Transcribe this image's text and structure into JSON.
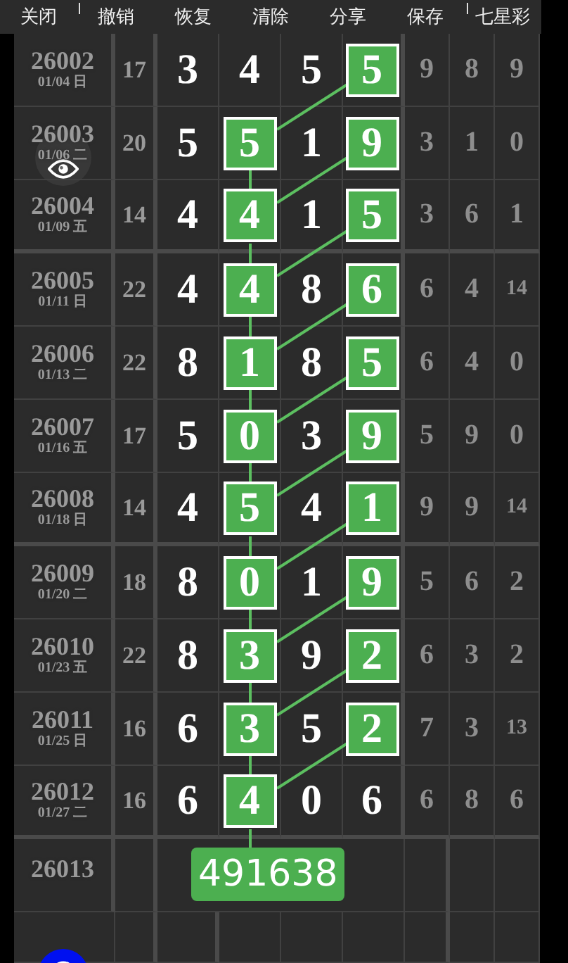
{
  "toolbar": [
    {
      "label": "关闭"
    },
    {
      "label": "撤销"
    },
    {
      "label": "恢复"
    },
    {
      "label": "清除"
    },
    {
      "label": "分享"
    },
    {
      "label": "保存"
    },
    {
      "label": "七星彩"
    }
  ],
  "rows": [
    {
      "issue": "26002",
      "date": "01/04 日",
      "sum": "17",
      "digits": [
        {
          "value": "3",
          "marked": false
        },
        {
          "value": "4",
          "marked": false
        },
        {
          "value": "5",
          "marked": false
        },
        {
          "value": "5",
          "marked": true
        }
      ],
      "extra": [
        "9",
        "8",
        "9"
      ]
    },
    {
      "issue": "26003",
      "date": "01/06 二",
      "sum": "20",
      "digits": [
        {
          "value": "5",
          "marked": false
        },
        {
          "value": "5",
          "marked": true
        },
        {
          "value": "1",
          "marked": false
        },
        {
          "value": "9",
          "marked": true
        }
      ],
      "extra": [
        "3",
        "1",
        "0"
      ]
    },
    {
      "issue": "26004",
      "date": "01/09 五",
      "sum": "14",
      "digits": [
        {
          "value": "4",
          "marked": false
        },
        {
          "value": "4",
          "marked": true
        },
        {
          "value": "1",
          "marked": false
        },
        {
          "value": "5",
          "marked": true
        }
      ],
      "extra": [
        "3",
        "6",
        "1"
      ]
    },
    {
      "issue": "26005",
      "date": "01/11 日",
      "sum": "22",
      "digits": [
        {
          "value": "4",
          "marked": false
        },
        {
          "value": "4",
          "marked": true
        },
        {
          "value": "8",
          "marked": false
        },
        {
          "value": "6",
          "marked": true
        }
      ],
      "extra": [
        "6",
        "4",
        "14"
      ]
    },
    {
      "issue": "26006",
      "date": "01/13 二",
      "sum": "22",
      "digits": [
        {
          "value": "8",
          "marked": false
        },
        {
          "value": "1",
          "marked": true
        },
        {
          "value": "8",
          "marked": false
        },
        {
          "value": "5",
          "marked": true
        }
      ],
      "extra": [
        "6",
        "4",
        "0"
      ]
    },
    {
      "issue": "26007",
      "date": "01/16 五",
      "sum": "17",
      "digits": [
        {
          "value": "5",
          "marked": false
        },
        {
          "value": "0",
          "marked": true
        },
        {
          "value": "3",
          "marked": false
        },
        {
          "value": "9",
          "marked": true
        }
      ],
      "extra": [
        "5",
        "9",
        "0"
      ]
    },
    {
      "issue": "26008",
      "date": "01/18 日",
      "sum": "14",
      "digits": [
        {
          "value": "4",
          "marked": false
        },
        {
          "value": "5",
          "marked": true
        },
        {
          "value": "4",
          "marked": false
        },
        {
          "value": "1",
          "marked": true
        }
      ],
      "extra": [
        "9",
        "9",
        "14"
      ]
    },
    {
      "issue": "26009",
      "date": "01/20 二",
      "sum": "18",
      "digits": [
        {
          "value": "8",
          "marked": false
        },
        {
          "value": "0",
          "marked": true
        },
        {
          "value": "1",
          "marked": false
        },
        {
          "value": "9",
          "marked": true
        }
      ],
      "extra": [
        "5",
        "6",
        "2"
      ]
    },
    {
      "issue": "26010",
      "date": "01/23 五",
      "sum": "22",
      "digits": [
        {
          "value": "8",
          "marked": false
        },
        {
          "value": "3",
          "marked": true
        },
        {
          "value": "9",
          "marked": false
        },
        {
          "value": "2",
          "marked": true
        }
      ],
      "extra": [
        "6",
        "3",
        "2"
      ]
    },
    {
      "issue": "26011",
      "date": "01/25 日",
      "sum": "16",
      "digits": [
        {
          "value": "6",
          "marked": false
        },
        {
          "value": "3",
          "marked": true
        },
        {
          "value": "5",
          "marked": false
        },
        {
          "value": "2",
          "marked": true
        }
      ],
      "extra": [
        "7",
        "3",
        "13"
      ]
    },
    {
      "issue": "26012",
      "date": "01/27 二",
      "sum": "16",
      "digits": [
        {
          "value": "6",
          "marked": false
        },
        {
          "value": "4",
          "marked": true
        },
        {
          "value": "0",
          "marked": false
        },
        {
          "value": "6",
          "marked": false
        }
      ],
      "extra": [
        "6",
        "8",
        "6"
      ]
    }
  ],
  "next": {
    "issue": "26013",
    "prediction": "491638"
  }
}
